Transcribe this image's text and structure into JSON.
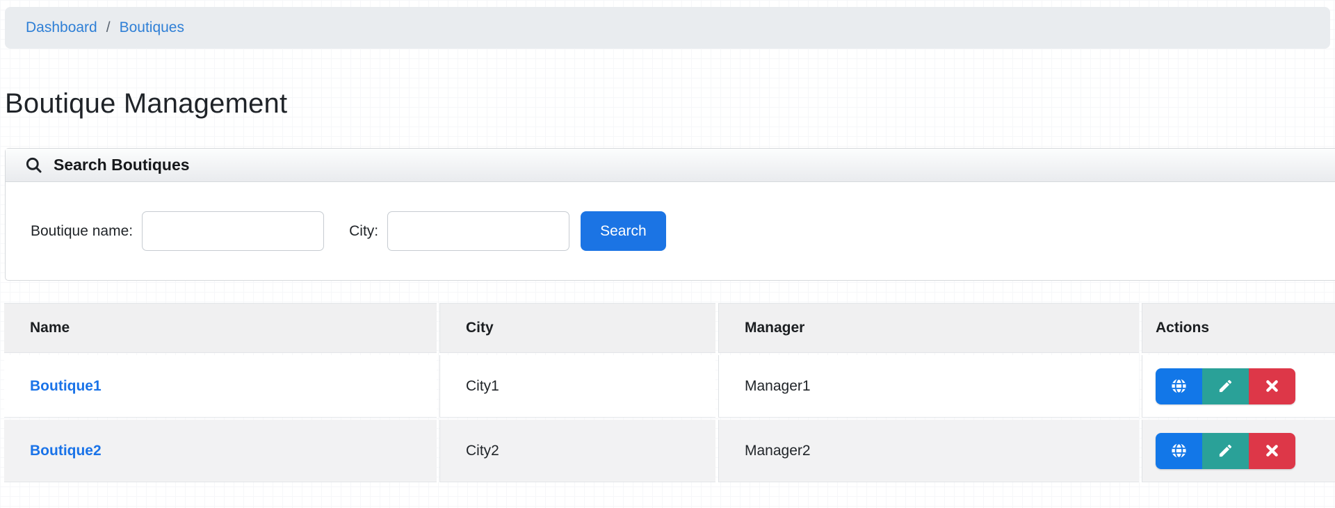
{
  "breadcrumb": {
    "separator": "/",
    "items": [
      {
        "label": "Dashboard"
      },
      {
        "label": "Boutiques"
      }
    ]
  },
  "page": {
    "title": "Boutique Management"
  },
  "search_panel": {
    "title": "Search Boutiques",
    "fields": [
      {
        "label": "Boutique name:",
        "value": "",
        "placeholder": ""
      },
      {
        "label": "City:",
        "value": "",
        "placeholder": ""
      }
    ],
    "submit_label": "Search"
  },
  "table": {
    "columns": [
      "Name",
      "City",
      "Manager",
      "Actions"
    ],
    "rows": [
      {
        "name": "Boutique1",
        "city": "City1",
        "manager": "Manager1"
      },
      {
        "name": "Boutique2",
        "city": "City2",
        "manager": "Manager2"
      }
    ],
    "row_actions": [
      {
        "name": "website",
        "icon": "globe-icon"
      },
      {
        "name": "edit",
        "icon": "pencil-icon"
      },
      {
        "name": "delete",
        "icon": "x-icon"
      }
    ]
  },
  "colors": {
    "primary_blue": "#1b74e4",
    "link_blue": "#1a73e8",
    "breadcrumb_blue": "#2e7fd6",
    "action_blue": "#1277e8",
    "action_teal": "#2aa198",
    "action_red": "#dd3748",
    "header_gray": "#f0f0f1",
    "stripe_gray": "#f2f2f3",
    "breadcrumb_bg": "#e9ecef"
  }
}
